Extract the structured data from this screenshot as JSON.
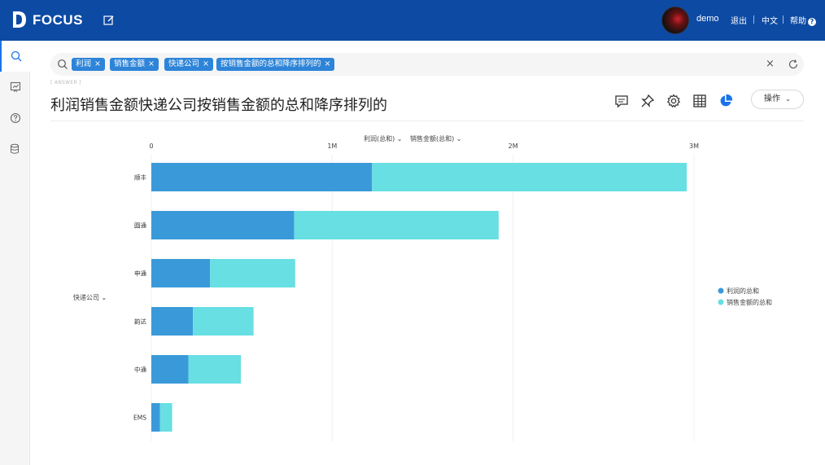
{
  "brand": "FOCUS",
  "user": {
    "name": "demo"
  },
  "top_links": {
    "logout": "退出",
    "language": "中文",
    "help": "帮助"
  },
  "search": {
    "tokens": [
      "利润",
      "销售金额",
      "快递公司",
      "按销售金额的总和降序排列的"
    ]
  },
  "answer_label": "ANSWER",
  "page_title": "利润销售金额快递公司按销售金额的总和降序排列的",
  "operations_button": "操作",
  "chart_controls": {
    "x_selector_1": "利润(总和)",
    "x_selector_2": "销售金额(总和)",
    "y_selector": "快递公司"
  },
  "colors": {
    "profit": "#3a9ad9",
    "sales": "#67dfe3",
    "brand_blue": "#0d4aa3"
  },
  "chart_data": {
    "type": "bar",
    "orientation": "horizontal",
    "stacked": true,
    "categories": [
      "顺丰",
      "圆通",
      "申通",
      "韵达",
      "中通",
      "EMS"
    ],
    "series": [
      {
        "name": "利润的总和",
        "values": [
          1220000,
          790000,
          325000,
          230000,
          205000,
          48000
        ]
      },
      {
        "name": "销售金额的总和",
        "values": [
          1740000,
          1130000,
          470000,
          335000,
          290000,
          67000
        ]
      }
    ],
    "x_ticks": [
      "0",
      "1M",
      "2M",
      "3M"
    ],
    "xlim": [
      0,
      3000000
    ],
    "legend_position": "right",
    "grid": true
  }
}
